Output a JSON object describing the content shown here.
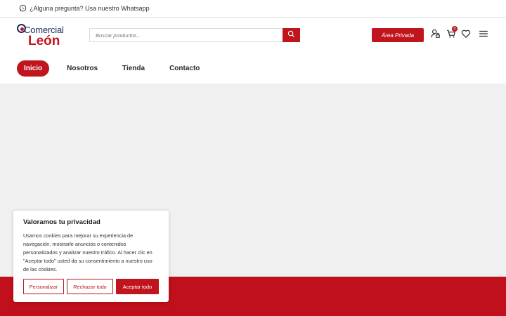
{
  "topbar": {
    "whatsapp_text": "¿Alguna pregunta? Usa nuestro Whatsapp"
  },
  "logo": {
    "line1": "Comercial",
    "line2": "León"
  },
  "search": {
    "placeholder": "Buscar productos..."
  },
  "header": {
    "area_privada": "Área Privada",
    "cart_count": "0"
  },
  "nav": {
    "items": [
      {
        "label": "Inicio"
      },
      {
        "label": "Nosotros"
      },
      {
        "label": "Tienda"
      },
      {
        "label": "Contacto"
      }
    ]
  },
  "cookie": {
    "title": "Valoramos tu privacidad",
    "text": "Usamos cookies para mejorar su experiencia de navegación, mostrarle anuncios o contenidos personalizados y analizar nuestro tráfico. Al hacer clic en \"Aceptar todo\" usted da su consentimiento a nuestro uso de las cookies.",
    "customize": "Personalizar",
    "reject": "Rechazar todo",
    "accept": "Aceptar todo"
  },
  "colors": {
    "brand_red": "#c0151d",
    "navy": "#1d2a5b"
  },
  "icons": [
    "whatsapp-icon",
    "search-icon",
    "user-lock-icon",
    "cart-icon",
    "heart-icon",
    "menu-icon"
  ]
}
